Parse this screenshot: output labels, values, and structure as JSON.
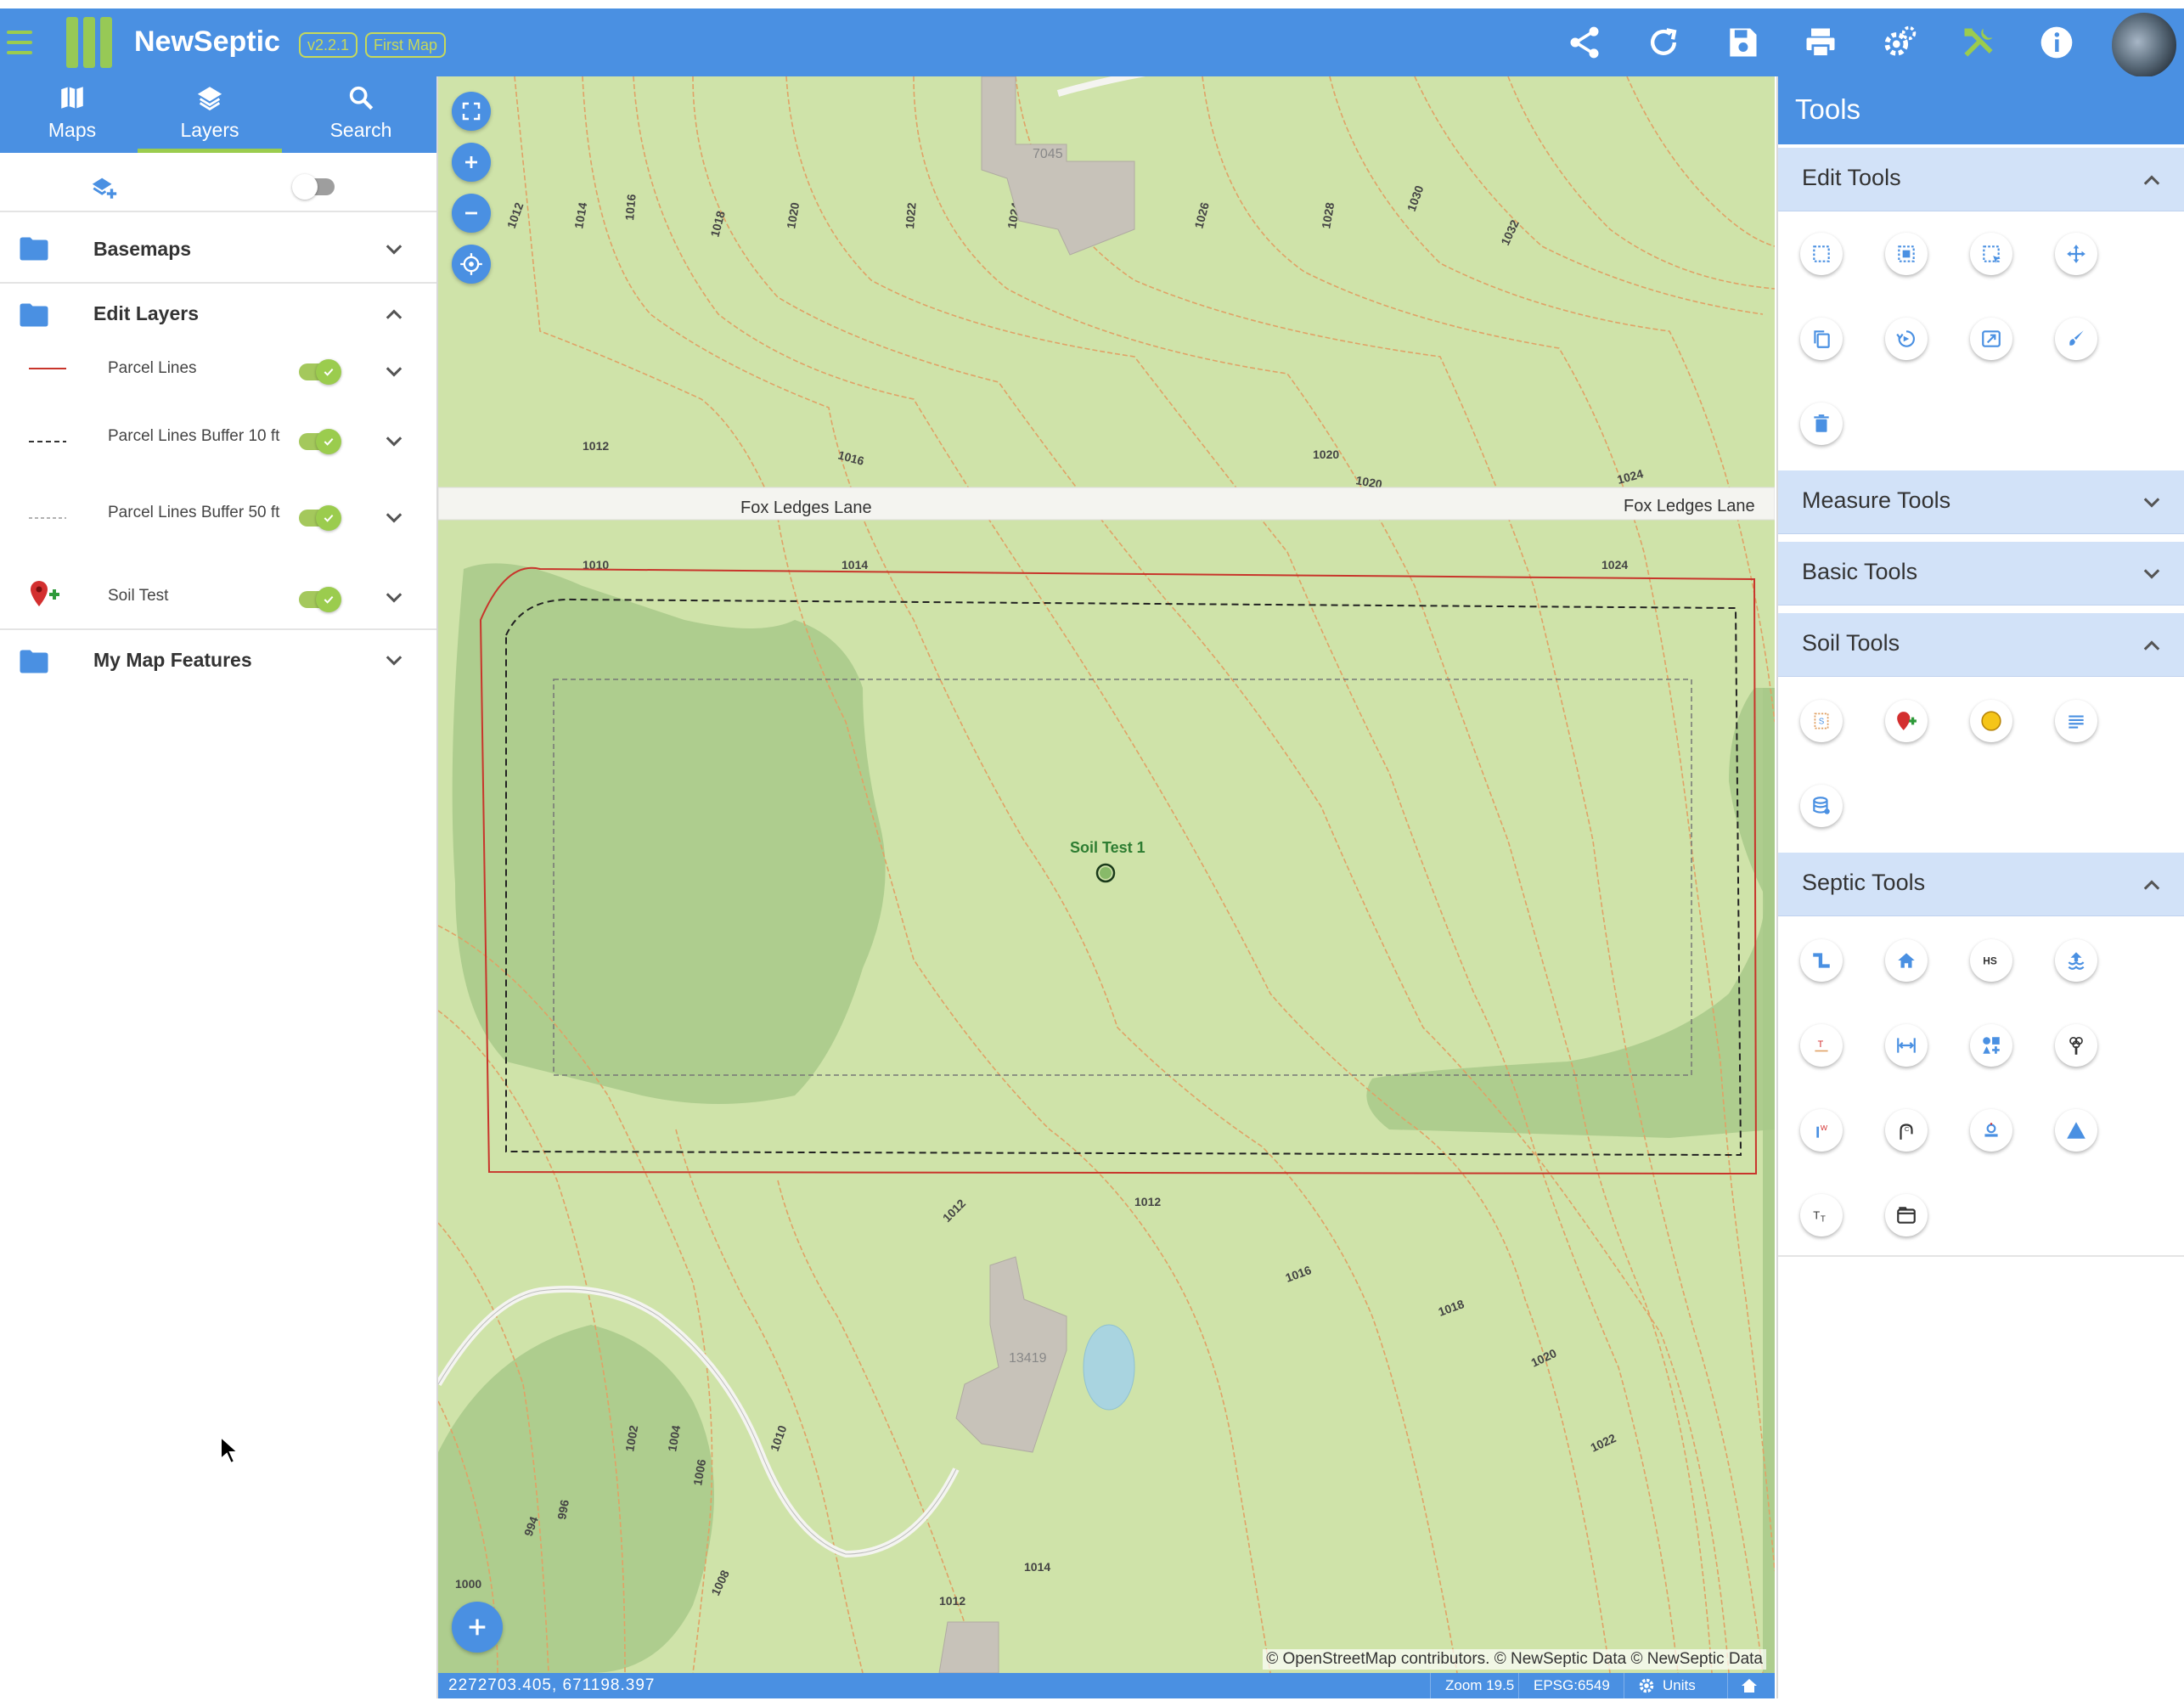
{
  "app": {
    "title": "NewSeptic",
    "version": "v2.2.1",
    "map_name": "First Map"
  },
  "toolbar": {
    "icons": [
      "share-icon",
      "refresh-icon",
      "save-icon",
      "print-icon",
      "settings-icon",
      "tools-icon",
      "info-icon"
    ],
    "tools_icon_color": "#9bcc4e"
  },
  "left_tabs": [
    {
      "label": "Maps",
      "icon": "map-icon"
    },
    {
      "label": "Layers",
      "icon": "layers-icon",
      "active": true
    },
    {
      "label": "Search",
      "icon": "search-icon"
    }
  ],
  "layers": {
    "groups": {
      "basemaps": "Basemaps",
      "edit_layers": "Edit Layers",
      "my_map_features": "My Map Features"
    },
    "items": [
      {
        "label": "Parcel Lines",
        "enabled": true,
        "symbol": "solid-red-line"
      },
      {
        "label": "Parcel Lines Buffer 10 ft",
        "enabled": true,
        "symbol": "dashed-dark-line"
      },
      {
        "label": "Parcel Lines Buffer 50 ft",
        "enabled": true,
        "symbol": "dashed-light-line"
      },
      {
        "label": "Soil Test",
        "enabled": true,
        "symbol": "red-pin-icon"
      }
    ]
  },
  "map": {
    "road_label": "Fox Ledges Lane",
    "house_numbers": [
      "7045",
      "13419"
    ],
    "feature_label": "Soil Test 1",
    "contour_labels": {
      "top": [
        "1012",
        "1014",
        "1016",
        "1018",
        "1020",
        "1022",
        "1024",
        "1026",
        "1028",
        "1030",
        "1032"
      ],
      "bottom": [
        "994",
        "996",
        "1000",
        "1002",
        "1004",
        "1006",
        "1008",
        "1010"
      ]
    },
    "attribution": "© OpenStreetMap contributors. © NewSeptic Data © NewSeptic Data",
    "colors": {
      "land": "#cfe3a9",
      "forest": "#a8c98a",
      "contour": "#e0a266",
      "parcel": "#c8352b",
      "road": "#f4f4f0"
    }
  },
  "statusbar": {
    "coordinates": "2272703.405, 671198.397",
    "zoom": "Zoom 19.5",
    "epsg": "EPSG:6549",
    "units": "Units"
  },
  "tools_panel": {
    "title": "Tools",
    "sections": {
      "edit": "Edit Tools",
      "measure": "Measure Tools",
      "basic": "Basic Tools",
      "soil": "Soil Tools",
      "septic": "Septic Tools"
    },
    "edit_tools": [
      "select-rect-icon",
      "select-multi-icon",
      "select-area-icon",
      "move-icon",
      "copy-icon",
      "rotate-icon",
      "scale-icon",
      "style-icon",
      "delete-icon"
    ],
    "soil_tools": [
      "soil-sample-icon",
      "soil-pin-icon",
      "soil-circle-icon",
      "soil-list-icon",
      "soil-db-icon"
    ],
    "septic_tools": [
      "pipe-icon",
      "house-icon",
      "hs-icon",
      "drainfield-icon",
      "tank-icon",
      "distance-icon",
      "components-icon",
      "tree-icon",
      "well-icon",
      "curve-icon",
      "pump-icon",
      "triangle-icon",
      "text-size-icon",
      "folder-tool-icon"
    ]
  }
}
